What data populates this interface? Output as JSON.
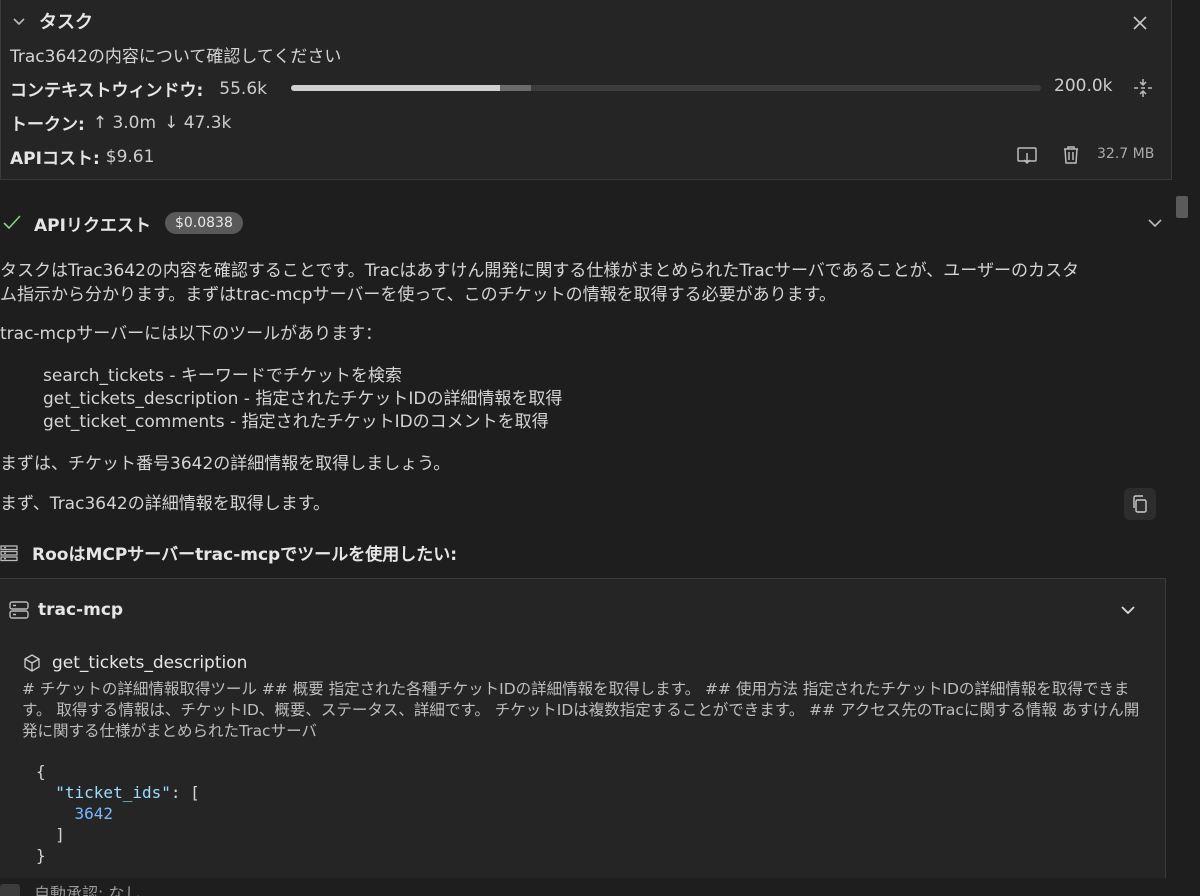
{
  "task": {
    "title": "タスク",
    "description": "Trac3642の内容について確認してください",
    "context_label": "コンテキストウィンドウ:",
    "context_used": "55.6k",
    "context_max": "200.0k",
    "context_used_fraction": 0.278,
    "context_reserved_fraction": 0.042,
    "tokens_label": "トークン:",
    "tokens_in": "↑ 3.0m",
    "tokens_out": "↓ 47.3k",
    "cost_label": "APIコスト:",
    "cost_value": "$9.61",
    "memory": "32.7 MB"
  },
  "api_request": {
    "title": "APIリクエスト",
    "cost": "$0.0838"
  },
  "messages": {
    "p1_line1": "タスクはTrac3642の内容を確認することです。Tracはあすけん開発に関する仕様がまとめられたTracサーバであることが、ユーザーのカスタ",
    "p1_line2": "ム指示から分かります。まずはtrac-mcpサーバーを使って、このチケットの情報を取得する必要があります。",
    "p2": "trac-mcpサーバーには以下のツールがあります：",
    "tools": [
      "search_tickets - キーワードでチケットを検索",
      "get_tickets_description - 指定されたチケットIDの詳細情報を取得",
      "get_ticket_comments - 指定されたチケットIDのコメントを取得"
    ],
    "p3": "まずは、チケット番号3642の詳細情報を取得しましょう。",
    "p4": "まず、Trac3642の詳細情報を取得します。"
  },
  "mcp": {
    "ask": "RooはMCPサーバーtrac-mcpでツールを使用したい:",
    "server": "trac-mcp",
    "tool_name": "get_tickets_description",
    "tool_desc": "# チケットの詳細情報取得ツール ## 概要 指定された各種チケットIDの詳細情報を取得します。 ## 使用方法 指定されたチケットIDの詳細情報を取得できます。 取得する情報は、チケットID、概要、ステータス、詳細です。 チケットIDは複数指定することができます。 ## アクセス先のTracに関する情報 あすけん開発に関する仕様がまとめられたTracサーバ",
    "code_open": "{",
    "code_key": "\"ticket_ids\"",
    "code_colon": ": [",
    "code_value": "3642",
    "code_close_arr": "]",
    "code_close": "}"
  },
  "bottom": {
    "text": "自動承認: なし"
  }
}
